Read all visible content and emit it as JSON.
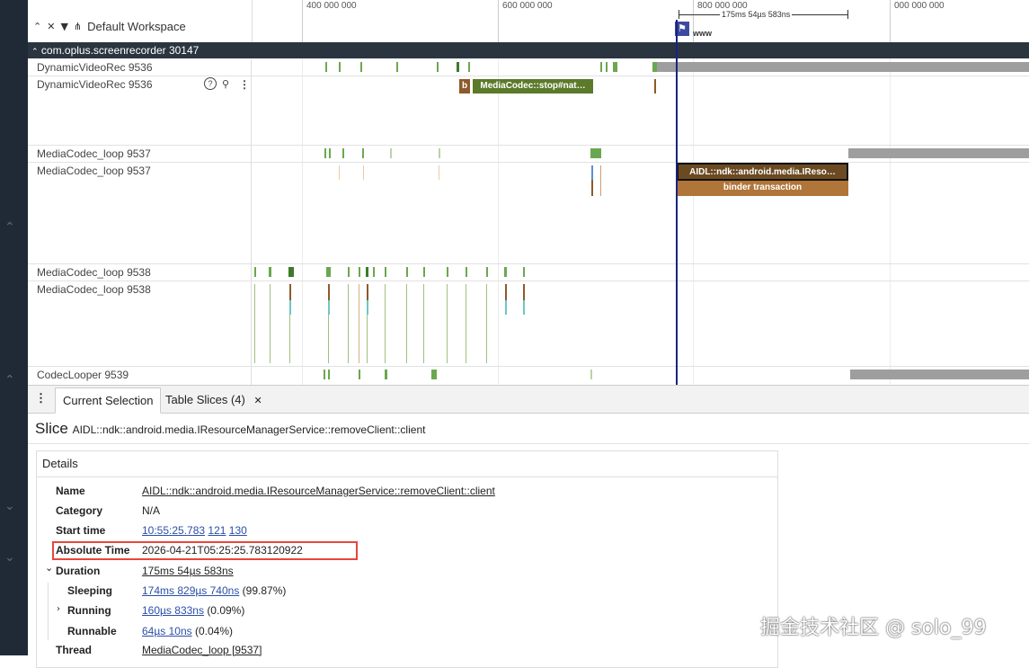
{
  "header": {
    "workspace_label": "Default Workspace",
    "ruler_ticks": [
      "400 000 000",
      "600 000 000",
      "800 000 000",
      "000 000 000"
    ],
    "measure_label": "175ms 54µs 583ns",
    "flag_label": "www"
  },
  "process": {
    "title": "com.oplus.screenrecorder 30147"
  },
  "tracks": [
    {
      "label": "DynamicVideoRec 9536"
    },
    {
      "label": "DynamicVideoRec 9536"
    },
    {
      "label": "MediaCodec_loop 9537"
    },
    {
      "label": "MediaCodec_loop 9537"
    },
    {
      "label": "MediaCodec_loop 9538"
    },
    {
      "label": "MediaCodec_loop 9538"
    },
    {
      "label": "CodecLooper 9539"
    }
  ],
  "slices": {
    "b_label": "b",
    "stop_label": "MediaCodec::stop#nat…",
    "aidl_label": "AIDL::ndk::android.media.IReso…",
    "binder_label": "binder transaction"
  },
  "colors": {
    "sidebar": "#1f2a36",
    "process_bar": "#2b3540",
    "cursor": "#1a237e",
    "highlight": "#e8463a",
    "link": "#2b4fa8",
    "slice_green": "#5b8a2f",
    "slice_brown": "#8d5a2b"
  },
  "bottom": {
    "tabs": [
      "Current Selection",
      "Table Slices (4)"
    ],
    "slice_heading": "Slice",
    "slice_name": "AIDL::ndk::android.media.IResourceManagerService::removeClient::client",
    "details_title": "Details",
    "details": {
      "name_key": "Name",
      "name_val": "AIDL::ndk::android.media.IResourceManagerService::removeClient::client",
      "category_key": "Category",
      "category_val": "N/A",
      "start_key": "Start time",
      "start_val_a": "10:55:25.783",
      "start_val_b": "121",
      "start_val_c": "130",
      "abs_key": "Absolute Time",
      "abs_val": "2026-04-21T05:25:25.783120922",
      "duration_key": "Duration",
      "duration_val": "175ms 54µs 583ns",
      "sleeping_key": "Sleeping",
      "sleeping_val": "174ms 829µs 740ns",
      "sleeping_pct": "(99.87%)",
      "running_key": "Running",
      "running_val": "160µs 833ns",
      "running_pct": "(0.09%)",
      "runnable_key": "Runnable",
      "runnable_val": "64µs 10ns",
      "runnable_pct": "(0.04%)",
      "thread_key": "Thread",
      "thread_val": "MediaCodec_loop [9537]"
    }
  },
  "watermark": "掘金技术社区 @ solo_99"
}
